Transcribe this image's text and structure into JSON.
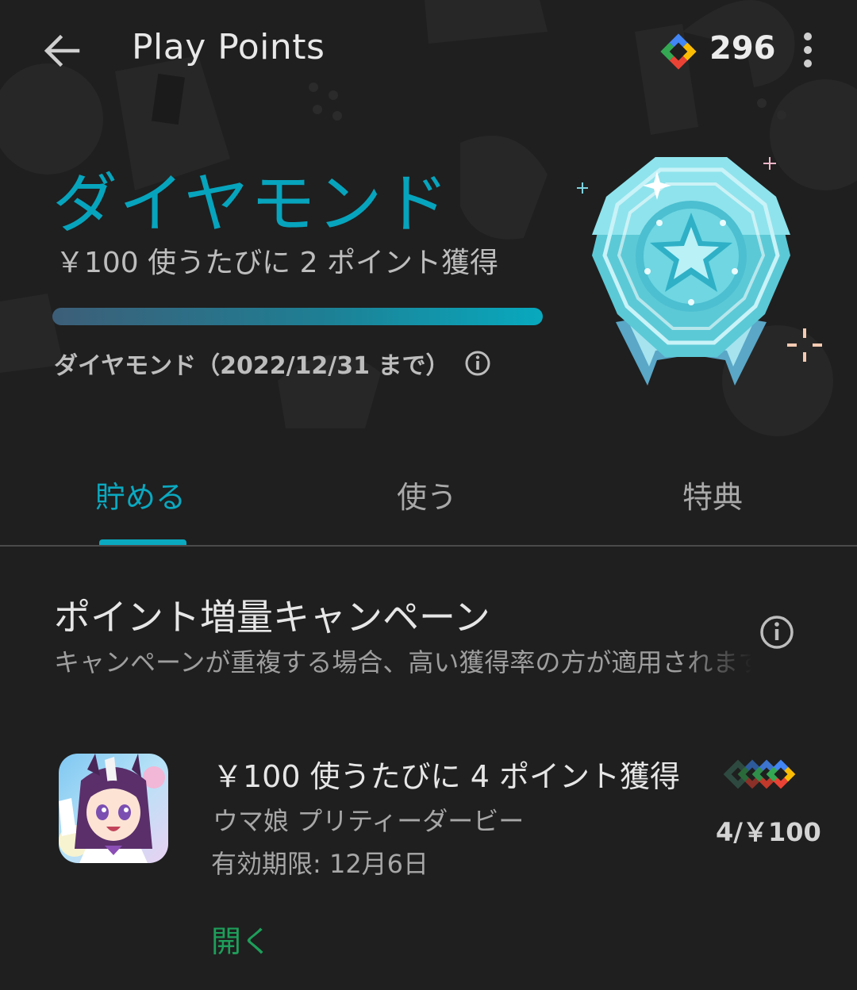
{
  "header": {
    "title": "Play Points",
    "points": "296",
    "back_icon": "arrow-back-icon",
    "menu_icon": "more-vert-icon"
  },
  "tier": {
    "name": "ダイヤモンド",
    "earn_rate": "￥100 使うたびに 2 ポイント獲得",
    "progress": 1.0,
    "status": "ダイヤモンド（2022/12/31 まで）",
    "badge_icon": "diamond-medal-icon"
  },
  "tabs": [
    {
      "label": "貯める",
      "active": true
    },
    {
      "label": "使う",
      "active": false
    },
    {
      "label": "特典",
      "active": false
    }
  ],
  "campaign": {
    "title": "ポイント増量キャンペーン",
    "description": "キャンペーンが重複する場合、高い獲得率の方が適用されます",
    "offers": [
      {
        "title": "￥100 使うたびに 4 ポイント獲得",
        "app_name": "ウマ娘 プリティーダービー",
        "expiry": "有効期限: 12月6日",
        "rate": "4/￥100",
        "action": "開く"
      }
    ]
  },
  "colors": {
    "background": "#1f1f1f",
    "accent": "#0aa9c0",
    "link": "#1e9e5a"
  }
}
